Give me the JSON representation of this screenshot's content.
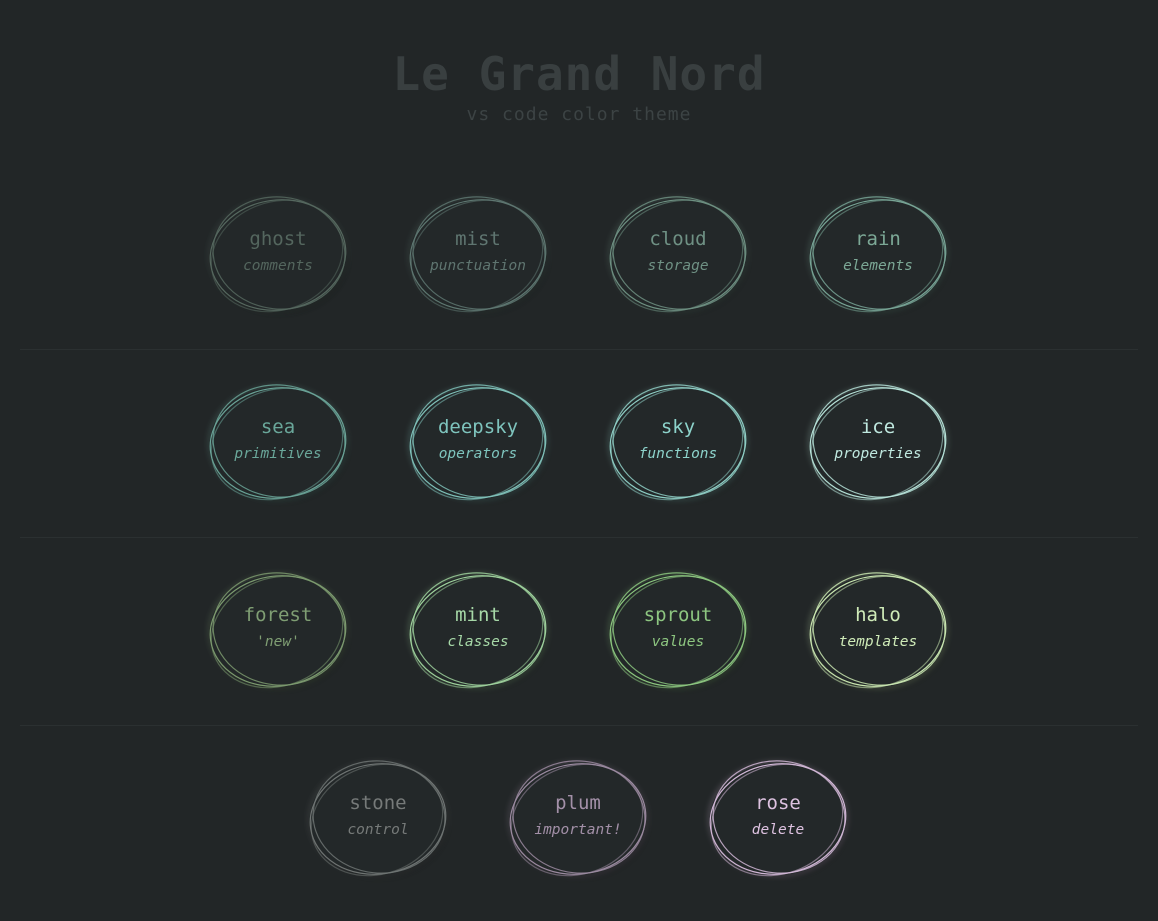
{
  "header": {
    "title": "Le Grand Nord",
    "subtitle": "vs code color theme"
  },
  "rows": [
    [
      {
        "name": "ghost",
        "role": "comments",
        "color": "#56685f",
        "text": "#54665e"
      },
      {
        "name": "mist",
        "role": "punctuation",
        "color": "#5e7771",
        "text": "#5f7570"
      },
      {
        "name": "cloud",
        "role": "storage",
        "color": "#6e9082",
        "text": "#6f9184"
      },
      {
        "name": "rain",
        "role": "elements",
        "color": "#78a596",
        "text": "#7ca896"
      }
    ],
    [
      {
        "name": "sea",
        "role": "primitives",
        "color": "#6aa397",
        "text": "#6aa79a"
      },
      {
        "name": "deepsky",
        "role": "operators",
        "color": "#7fc1b9",
        "text": "#7ec4bd"
      },
      {
        "name": "sky",
        "role": "functions",
        "color": "#8fcfc6",
        "text": "#8dd3cb"
      },
      {
        "name": "ice",
        "role": "properties",
        "color": "#b6e2d8",
        "text": "#bfe8df"
      }
    ],
    [
      {
        "name": "forest",
        "role": "'new'",
        "color": "#7c9a6f",
        "text": "#7f9e73"
      },
      {
        "name": "mint",
        "role": "classes",
        "color": "#9ed19c",
        "text": "#a6d8a7"
      },
      {
        "name": "sprout",
        "role": "values",
        "color": "#8cc77f",
        "text": "#8dc680"
      },
      {
        "name": "halo",
        "role": "templates",
        "color": "#c9e6b0",
        "text": "#cfebb8"
      }
    ],
    [
      {
        "name": "stone",
        "role": "control",
        "color": "#6f7473",
        "text": "#767a79"
      },
      {
        "name": "plum",
        "role": "important!",
        "color": "#9b8aa0",
        "text": "#a390a8"
      },
      {
        "name": "rose",
        "role": "delete",
        "color": "#d1b7d6",
        "text": "#ddc2e0"
      }
    ]
  ]
}
